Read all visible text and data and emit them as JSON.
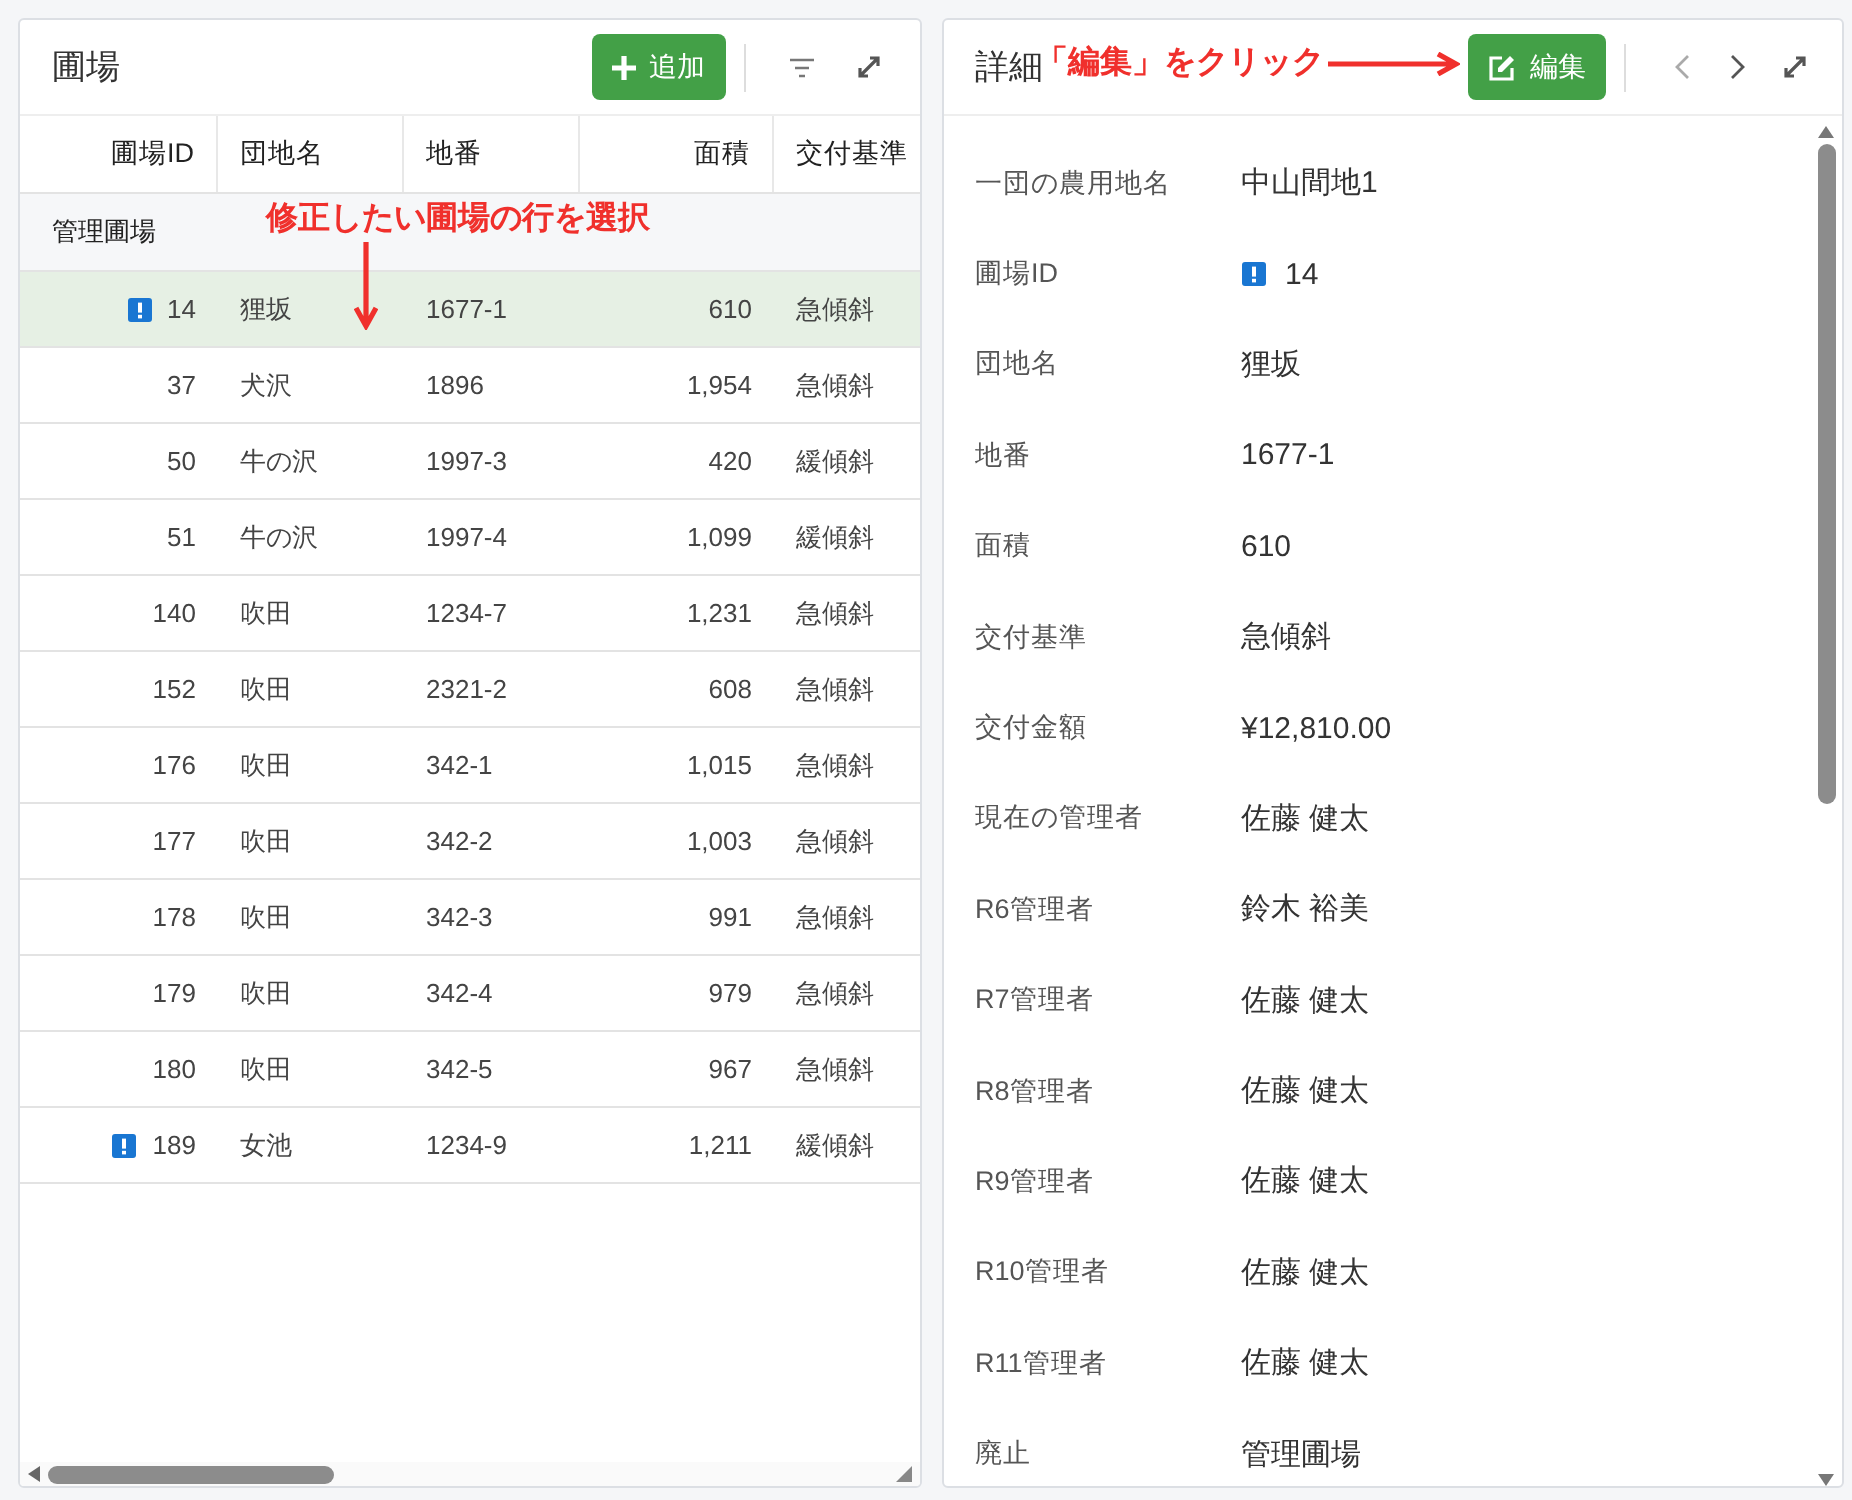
{
  "list_panel": {
    "title": "圃場",
    "add_button": "追加",
    "columns": [
      "圃場ID",
      "団地名",
      "地番",
      "面積",
      "交付基準"
    ],
    "group": "管理圃場",
    "rows": [
      {
        "id": "14",
        "warning": true,
        "selected": true,
        "danchi": "狸坂",
        "chiban": "1677-1",
        "area": "610",
        "standard": "急傾斜"
      },
      {
        "id": "37",
        "warning": false,
        "selected": false,
        "danchi": "犬沢",
        "chiban": "1896",
        "area": "1,954",
        "standard": "急傾斜"
      },
      {
        "id": "50",
        "warning": false,
        "selected": false,
        "danchi": "牛の沢",
        "chiban": "1997-3",
        "area": "420",
        "standard": "緩傾斜"
      },
      {
        "id": "51",
        "warning": false,
        "selected": false,
        "danchi": "牛の沢",
        "chiban": "1997-4",
        "area": "1,099",
        "standard": "緩傾斜"
      },
      {
        "id": "140",
        "warning": false,
        "selected": false,
        "danchi": "吹田",
        "chiban": "1234-7",
        "area": "1,231",
        "standard": "急傾斜"
      },
      {
        "id": "152",
        "warning": false,
        "selected": false,
        "danchi": "吹田",
        "chiban": "2321-2",
        "area": "608",
        "standard": "急傾斜"
      },
      {
        "id": "176",
        "warning": false,
        "selected": false,
        "danchi": "吹田",
        "chiban": "342-1",
        "area": "1,015",
        "standard": "急傾斜"
      },
      {
        "id": "177",
        "warning": false,
        "selected": false,
        "danchi": "吹田",
        "chiban": "342-2",
        "area": "1,003",
        "standard": "急傾斜"
      },
      {
        "id": "178",
        "warning": false,
        "selected": false,
        "danchi": "吹田",
        "chiban": "342-3",
        "area": "991",
        "standard": "急傾斜"
      },
      {
        "id": "179",
        "warning": false,
        "selected": false,
        "danchi": "吹田",
        "chiban": "342-4",
        "area": "979",
        "standard": "急傾斜"
      },
      {
        "id": "180",
        "warning": false,
        "selected": false,
        "danchi": "吹田",
        "chiban": "342-5",
        "area": "967",
        "standard": "急傾斜"
      },
      {
        "id": "189",
        "warning": true,
        "selected": false,
        "danchi": "女池",
        "chiban": "1234-9",
        "area": "1,211",
        "standard": "緩傾斜"
      }
    ]
  },
  "detail_panel": {
    "title": "詳細",
    "edit_button": "編集",
    "fields": [
      {
        "label": "一団の農用地名",
        "value": "中山間地1",
        "warning": false
      },
      {
        "label": "圃場ID",
        "value": "14",
        "warning": true
      },
      {
        "label": "団地名",
        "value": "狸坂",
        "warning": false
      },
      {
        "label": "地番",
        "value": "1677-1",
        "warning": false
      },
      {
        "label": "面積",
        "value": "610",
        "warning": false
      },
      {
        "label": "交付基準",
        "value": "急傾斜",
        "warning": false
      },
      {
        "label": "交付金額",
        "value": "¥12,810.00",
        "warning": false
      },
      {
        "label": "現在の管理者",
        "value": "佐藤 健太",
        "warning": false
      },
      {
        "label": "R6管理者",
        "value": "鈴木 裕美",
        "warning": false
      },
      {
        "label": "R7管理者",
        "value": "佐藤 健太",
        "warning": false
      },
      {
        "label": "R8管理者",
        "value": "佐藤 健太",
        "warning": false
      },
      {
        "label": "R9管理者",
        "value": "佐藤 健太",
        "warning": false
      },
      {
        "label": "R10管理者",
        "value": "佐藤 健太",
        "warning": false
      },
      {
        "label": "R11管理者",
        "value": "佐藤 健太",
        "warning": false
      },
      {
        "label": "廃止",
        "value": "管理圃場",
        "warning": false
      }
    ]
  },
  "annotations": [
    {
      "text": "修正したい圃場の行を選択",
      "kind": "down"
    },
    {
      "text": "「編集」をクリック",
      "kind": "right"
    }
  ]
}
